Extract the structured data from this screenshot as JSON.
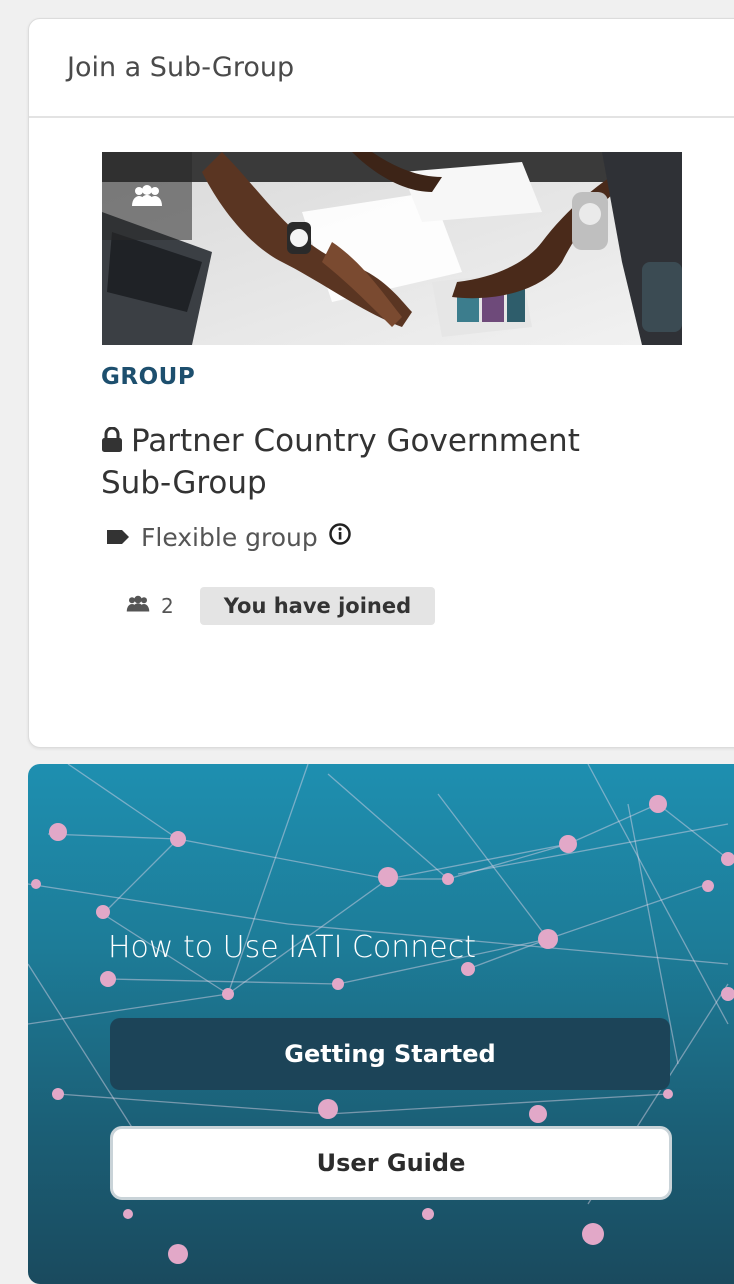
{
  "card": {
    "header_title": "Join a Sub-Group",
    "image_badge_icon": "users-icon",
    "kind_label": "GROUP",
    "title": "Partner Country Government Sub-Group",
    "title_icon": "lock-icon",
    "type_label": "Flexible group",
    "type_icon": "tag-icon",
    "type_info_icon": "info-icon",
    "member_icon": "users-icon",
    "member_count": "2",
    "status_badge": "You have joined"
  },
  "promo": {
    "title": "How to Use IATI Connect",
    "primary_button": "Getting Started",
    "secondary_button": "User Guide",
    "colors": {
      "primary_button_bg": "#1c4458",
      "kind_label": "#1d4f6e"
    }
  }
}
